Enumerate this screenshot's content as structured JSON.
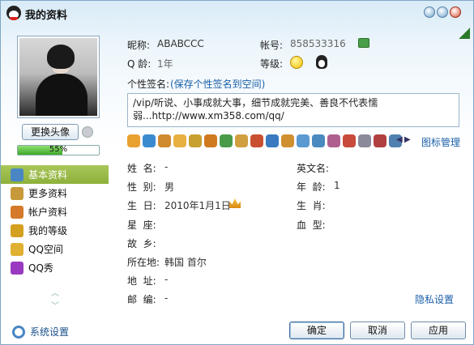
{
  "window": {
    "title": "我的资料"
  },
  "avatar": {
    "change_label": "更换头像",
    "completion": "55%",
    "completion_value": 55
  },
  "nav": {
    "items": [
      {
        "label": "基本资料",
        "color": "#4a86c4"
      },
      {
        "label": "更多资料",
        "color": "#c69a3a"
      },
      {
        "label": "帐户资料",
        "color": "#d47a2a"
      },
      {
        "label": "我的等级",
        "color": "#d4a020"
      },
      {
        "label": "QQ空间",
        "color": "#e0b030"
      },
      {
        "label": "QQ秀",
        "color": "#9a3ac0"
      }
    ],
    "settings_label": "系统设置"
  },
  "profile": {
    "nickname_label": "昵称:",
    "nickname": "ABABCCC",
    "account_label": "帐号:",
    "account": "858533316",
    "qage_label": "Q 龄:",
    "qage": "1年",
    "level_label": "等级:",
    "signature_label": "个性签名:",
    "signature_link": "(保存个性签名到空间)",
    "signature": "/vip/听说、小事成就大事，细节成就完美、善良不代表懦弱...http://www.xm358.com/qq/",
    "icon_manage": "图标管理"
  },
  "details": {
    "name_label": "姓  名:",
    "name": "-",
    "english_name_label": "英文名:",
    "english_name": "",
    "gender_label": "性  别:",
    "gender": "男",
    "age_label": "年  龄:",
    "age": "1",
    "birthday_label": "生  日:",
    "birthday": "2010年1月1日",
    "zodiac_label": "生  肖:",
    "zodiac": "",
    "constellation_label": "星  座:",
    "constellation": "",
    "blood_label": "血  型:",
    "blood": "",
    "hometown_label": "故  乡:",
    "hometown": "",
    "location_label": "所在地:",
    "location": "韩国 首尔",
    "address_label": "地  址:",
    "address": "-",
    "postcode_label": "邮  编:",
    "postcode": "-",
    "privacy_label": "隐私设置"
  },
  "buttons": {
    "ok": "确定",
    "cancel": "取消",
    "apply": "应用"
  }
}
